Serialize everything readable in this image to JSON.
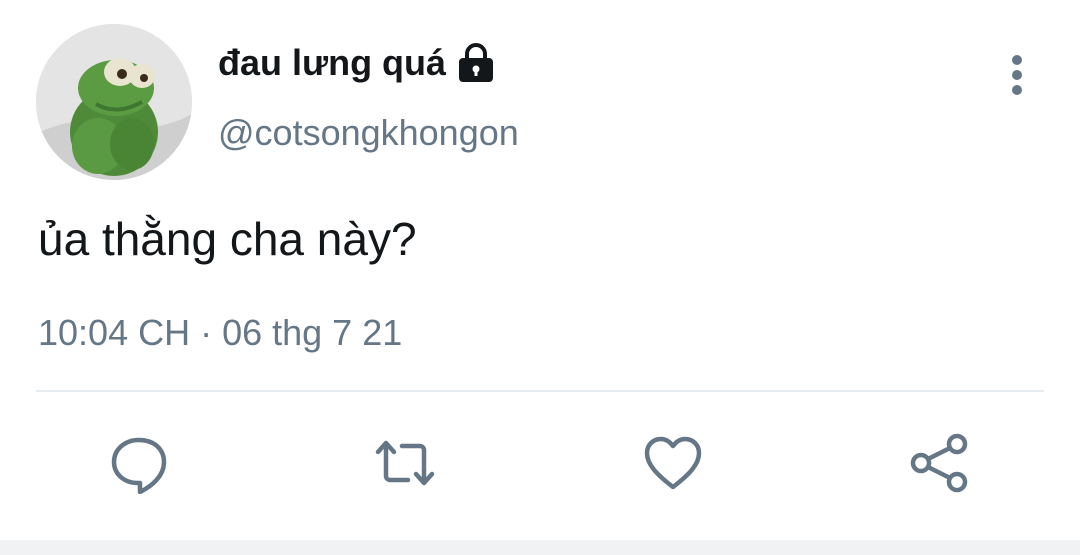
{
  "user": {
    "display_name": "đau lưng quá",
    "handle": "@cotsongkhongon",
    "protected": true,
    "avatar_icon": "kermit-avatar"
  },
  "tweet": {
    "text": "ủa thằng cha này?",
    "timestamp": "10:04 CH · 06 thg 7 21"
  },
  "actions": [
    {
      "name": "reply",
      "icon": "comment-icon"
    },
    {
      "name": "retweet",
      "icon": "retweet-icon"
    },
    {
      "name": "like",
      "icon": "heart-icon"
    },
    {
      "name": "share",
      "icon": "share-icon"
    }
  ],
  "colors": {
    "primary_text": "#14171a",
    "secondary_text": "#657786",
    "divider": "#e6ecf0"
  }
}
